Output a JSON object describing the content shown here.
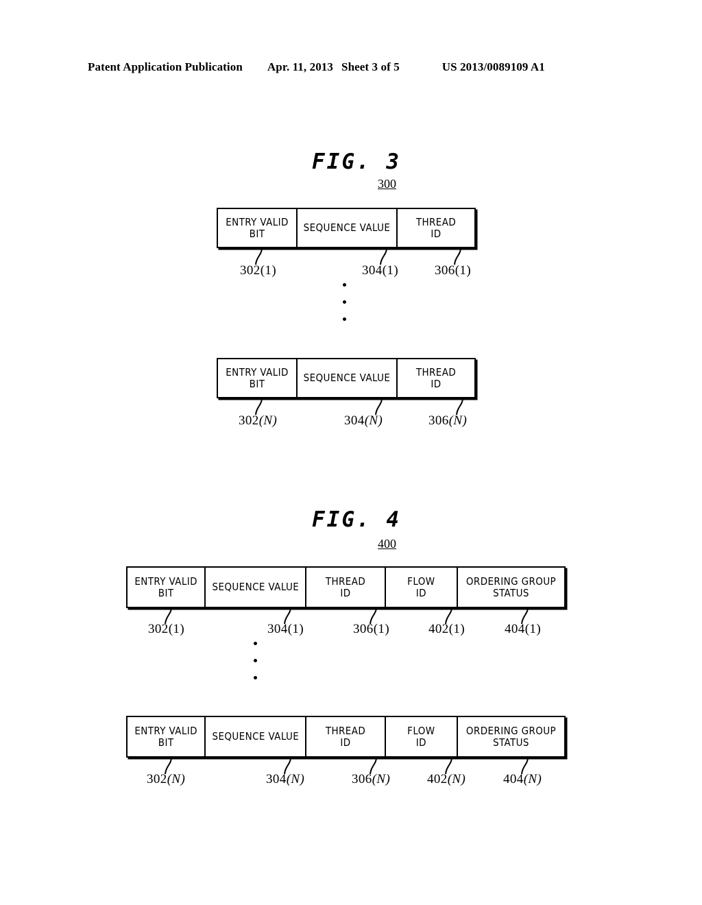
{
  "page_header": {
    "publication": "Patent Application Publication",
    "date": "Apr. 11, 2013",
    "sheet": "Sheet 3 of 5",
    "patent_number": "US 2013/0089109 A1"
  },
  "figures": [
    {
      "id": "fig3",
      "title": "FIG. 3",
      "reference_numeral": "300",
      "columns": [
        "ENTRY VALID\nBIT",
        "SEQUENCE VALUE",
        "THREAD\nID"
      ],
      "rows": [
        {
          "index": "1",
          "labels": [
            "302",
            "304",
            "306"
          ],
          "suffix": "(1)",
          "label_full": [
            "302(1)",
            "304(1)",
            "306(1)"
          ]
        },
        {
          "index": "N",
          "labels": [
            "302",
            "304",
            "306"
          ],
          "suffix": "(N)",
          "label_full": [
            "302(N)",
            "304(N)",
            "306(N)"
          ]
        }
      ],
      "ellipsis_dots": 3
    },
    {
      "id": "fig4",
      "title": "FIG. 4",
      "reference_numeral": "400",
      "columns": [
        "ENTRY VALID\nBIT",
        "SEQUENCE VALUE",
        "THREAD\nID",
        "FLOW\nID",
        "ORDERING GROUP\nSTATUS"
      ],
      "rows": [
        {
          "index": "1",
          "labels": [
            "302",
            "304",
            "306",
            "402",
            "404"
          ],
          "suffix": "(1)",
          "label_full": [
            "302(1)",
            "304(1)",
            "306(1)",
            "402(1)",
            "404(1)"
          ]
        },
        {
          "index": "N",
          "labels": [
            "302",
            "304",
            "306",
            "402",
            "404"
          ],
          "suffix": "(N)",
          "label_full": [
            "302(N)",
            "304(N)",
            "306(N)",
            "402(N)",
            "404(N)"
          ]
        }
      ],
      "ellipsis_dots": 3
    }
  ],
  "colors": {
    "ink": "#000000",
    "paper": "#ffffff"
  }
}
